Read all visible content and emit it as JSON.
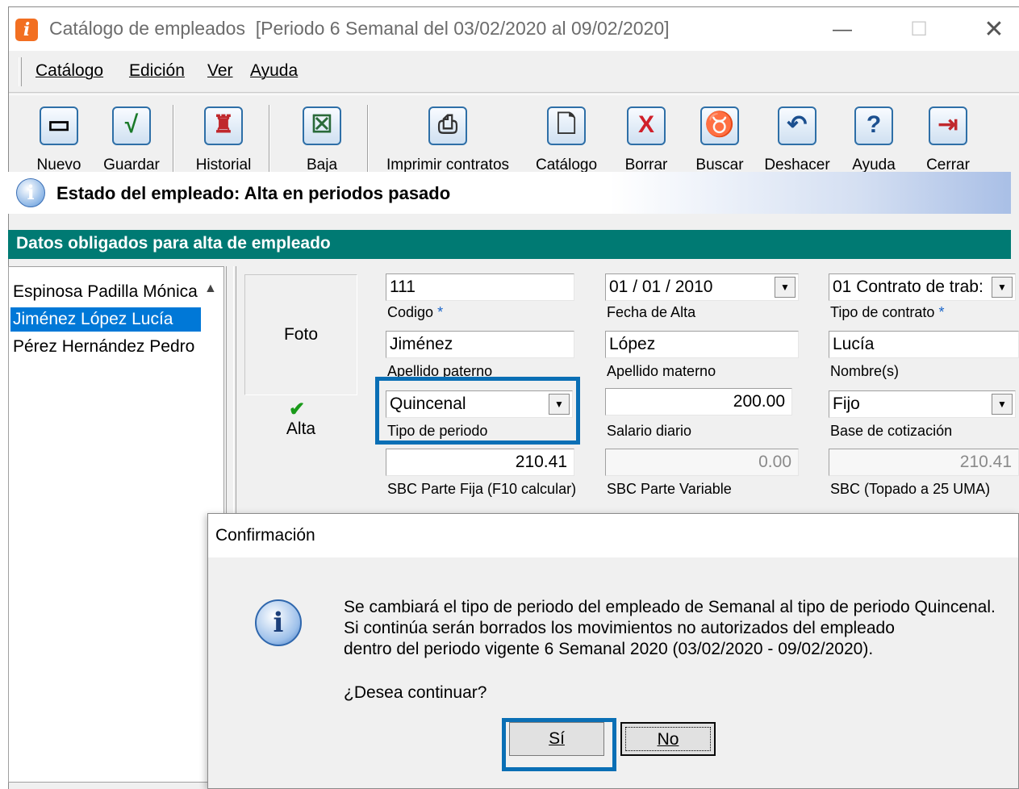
{
  "window": {
    "title": "Catálogo de empleados",
    "period": "[Periodo 6 Semanal del 03/02/2020 al 09/02/2020]",
    "min": "—",
    "max": "☐",
    "close": "✕"
  },
  "menu": [
    "Catálogo",
    "Edición",
    "Ver",
    "Ayuda"
  ],
  "toolbar": [
    {
      "label": "Nuevo",
      "icon": "new-document-icon",
      "glyph": "▭"
    },
    {
      "label": "Guardar",
      "icon": "checkmark-save-icon",
      "glyph": "√"
    },
    {
      "label": "Historial",
      "icon": "history-people-icon",
      "glyph": "♜"
    },
    {
      "label": "Baja",
      "icon": "remove-employee-icon",
      "glyph": "☒"
    },
    {
      "label": "Imprimir contratos",
      "icon": "printer-icon",
      "glyph": "⎙"
    },
    {
      "label": "Catálogo",
      "icon": "catalog-search-icon",
      "glyph": "🗋"
    },
    {
      "label": "Borrar",
      "icon": "delete-x-icon",
      "glyph": "X"
    },
    {
      "label": "Buscar",
      "icon": "binoculars-icon",
      "glyph": "♉"
    },
    {
      "label": "Deshacer",
      "icon": "undo-icon",
      "glyph": "↶"
    },
    {
      "label": "Ayuda",
      "icon": "help-question-icon",
      "glyph": "?"
    },
    {
      "label": "Cerrar",
      "icon": "exit-door-icon",
      "glyph": "⇥"
    }
  ],
  "status": {
    "icon": "info-icon",
    "text": "Estado del empleado: Alta en periodos pasado"
  },
  "section_title": "Datos obligados para alta de empleado",
  "employees": [
    {
      "name": "Espinosa Padilla Mónica",
      "selected": false
    },
    {
      "name": "Jiménez López Lucía",
      "selected": true
    },
    {
      "name": "Pérez Hernández Pedro",
      "selected": false
    }
  ],
  "form": {
    "foto": "Foto",
    "alta": "Alta",
    "codigo": {
      "value": "111",
      "label": "Codigo",
      "required": "*"
    },
    "fecha_alta": {
      "value": "01 / 01 / 2010",
      "label": "Fecha de Alta"
    },
    "tipo_contrato": {
      "value": "01 Contrato de trab:",
      "label": "Tipo de contrato",
      "required": "*"
    },
    "apellido_paterno": {
      "value": "Jiménez",
      "label": "Apellido paterno"
    },
    "apellido_materno": {
      "value": "López",
      "label": "Apellido materno"
    },
    "nombre": {
      "value": "Lucía",
      "label": "Nombre(s)"
    },
    "tipo_periodo": {
      "value": "Quincenal",
      "label": "Tipo de periodo"
    },
    "salario_diario": {
      "value": "200.00",
      "label": "Salario diario"
    },
    "base_cotizacion": {
      "value": "Fijo",
      "label": "Base de cotización"
    },
    "sbc_fija": {
      "value": "210.41",
      "label": "SBC Parte Fija (F10 calcular)"
    },
    "sbc_variable": {
      "value": "0.00",
      "label": "SBC Parte Variable"
    },
    "sbc_topado": {
      "value": "210.41",
      "label": "SBC (Topado a 25 UMA)"
    }
  },
  "dialog": {
    "title": "Confirmación",
    "lines": [
      "Se cambiará el tipo de periodo del empleado de Semanal al tipo de periodo Quincenal.",
      "Si continúa serán borrados los movimientos no autorizados del empleado",
      "dentro del periodo vigente 6 Semanal 2020 (03/02/2020 - 09/02/2020)."
    ],
    "question": "¿Desea continuar?",
    "yes_label": "Sí",
    "no_label": "No"
  },
  "colors": {
    "section": "#007a73",
    "selection": "#0078d7",
    "highlight": "#0a6fb5"
  }
}
